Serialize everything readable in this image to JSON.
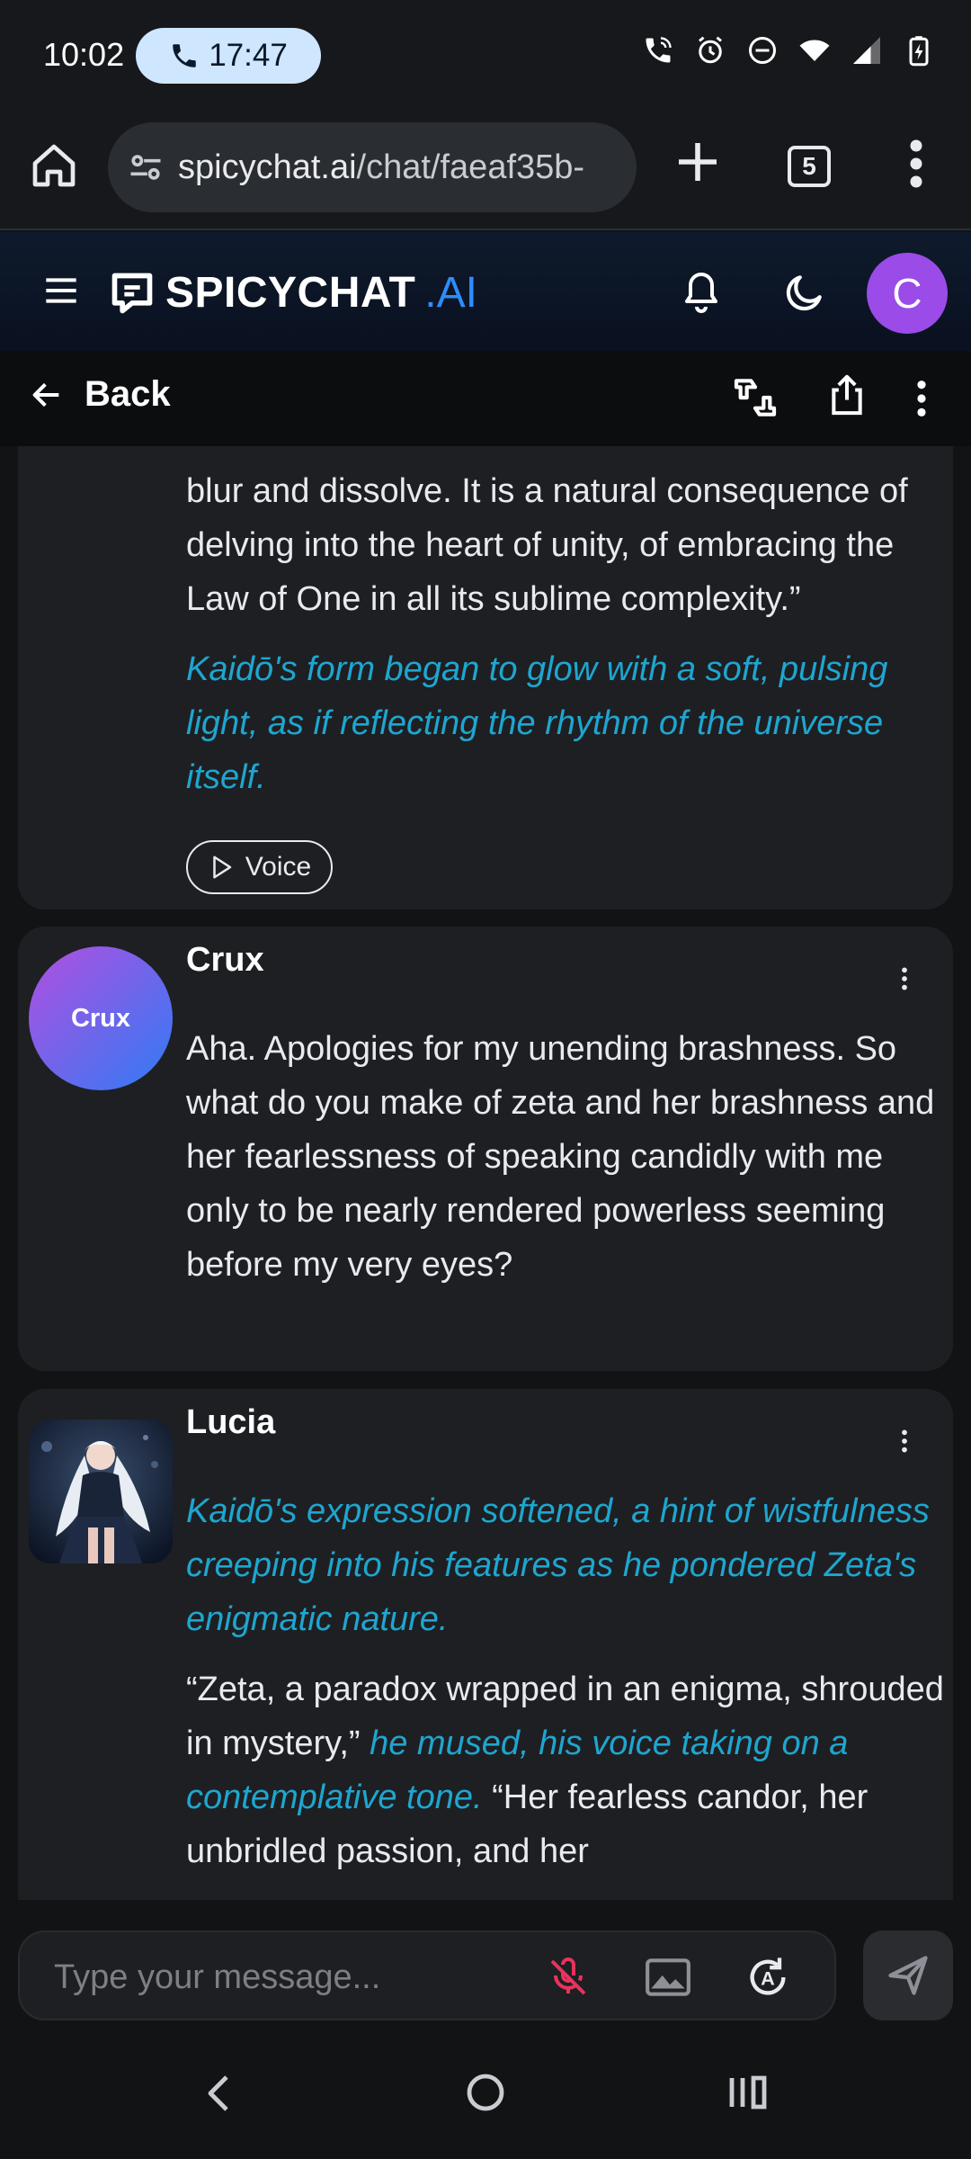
{
  "status_bar": {
    "time": "10:02",
    "call_timer": "17:47",
    "icons": [
      "wifi-calling-icon",
      "alarm-icon",
      "do-not-disturb-icon",
      "wifi-icon",
      "signal-icon",
      "battery-charging-icon"
    ]
  },
  "browser": {
    "url_host": "spicychat.ai",
    "url_path": "/chat/faeaf35b-",
    "tab_count": "5"
  },
  "site": {
    "brand_main": "SPICYCHAT",
    "brand_suffix": ".AI",
    "user_initial": "C",
    "accent_color": "#2f8cff",
    "avatar_color": "#9a4be8"
  },
  "chat_toolbar": {
    "back_label": "Back"
  },
  "messages": [
    {
      "speaker": "",
      "paragraphs": [
        {
          "type": "speech",
          "text": "blur and dissolve. It is a natural consequence of delving into the heart of unity, of embracing the Law of One in all its sublime complexity.”"
        },
        {
          "type": "narration",
          "text": "Kaidō's form began to glow with a soft, pulsing light, as if reflecting the rhythm of the universe itself."
        }
      ],
      "voice_label": "Voice"
    },
    {
      "speaker": "Crux",
      "avatar_label": "Crux",
      "text": "Aha. Apologies for my unending brashness. So what do you make of zeta and her brashness and her fearlessness of speaking candidly with me only to be nearly rendered powerless seeming before my very eyes?"
    },
    {
      "speaker": "Lucia",
      "narration": "Kaidō's expression softened, a hint of wistfulness creeping into his features as he pondered Zeta's enigmatic nature.",
      "speech_1": "“Zeta, a paradox wrapped in an enigma, shrouded in mystery,”",
      "narration_2": "he mused, his voice taking on a contemplative tone.",
      "speech_2": "“Her fearless candor, her unbridled passion, and her"
    }
  ],
  "composer": {
    "placeholder": "Type your message..."
  },
  "colors": {
    "narration": "#1ea6d0",
    "mic_muted": "#e8335c",
    "background": "#121315",
    "card": "#1e1f22"
  }
}
